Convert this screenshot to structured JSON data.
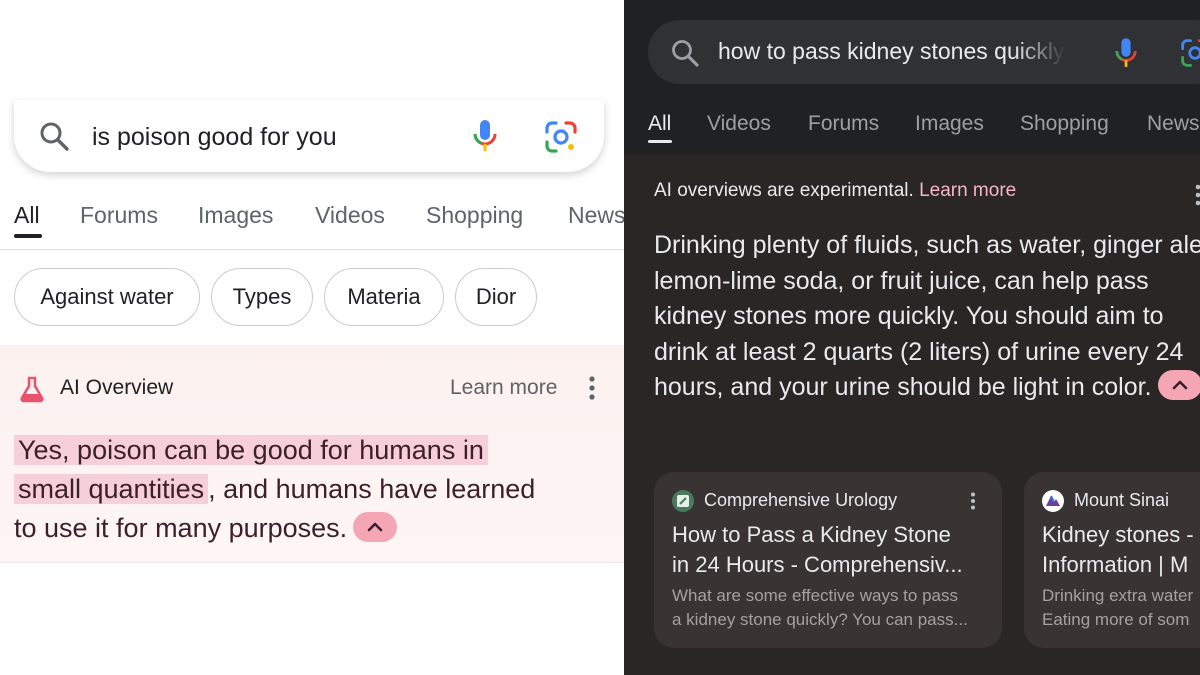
{
  "left": {
    "search": {
      "query": "is poison good for you"
    },
    "tabs": [
      "All",
      "Forums",
      "Images",
      "Videos",
      "Shopping",
      "News"
    ],
    "chips": [
      "Against water",
      "Types",
      "Materia",
      "Dior"
    ],
    "ai_overview": {
      "title": "AI Overview",
      "learn_more": "Learn more",
      "highlight_1": "Yes, poison can be good for humans in",
      "highlight_2": "small quantities",
      "rest_1": ", and humans have learned",
      "rest_2": "to use it for many purposes."
    }
  },
  "right": {
    "search": {
      "query": "how to pass kidney stones quickly"
    },
    "tabs": [
      "All",
      "Videos",
      "Forums",
      "Images",
      "Shopping",
      "News"
    ],
    "ai_overview": {
      "notice": "AI overviews are experimental.",
      "learn_more": "Learn more",
      "answer": "Drinking plenty of fluids, such as water, ginger ale, lemon-lime soda, or fruit juice, can help pass kidney stones more quickly. You should aim to drink at least 2 quarts (2 liters) of urine every 24 hours, and your urine should be light in color."
    },
    "cards": [
      {
        "source": "Comprehensive Urology",
        "title_1": "How to Pass a Kidney Stone",
        "title_2": "in 24 Hours - Comprehensiv...",
        "snippet_1": "What are some effective ways to pass",
        "snippet_2": "a kidney stone quickly? You can pass..."
      },
      {
        "source": "Mount Sinai",
        "title_1": "Kidney stones -",
        "title_2": "Information | M",
        "snippet_1": "Drinking extra water",
        "snippet_2": "Eating more of som"
      }
    ]
  },
  "colors": {
    "highlight_pink": "#f6cfd8",
    "pill_pink": "#f5a6b4",
    "dark_bg": "#202124",
    "dark_overview_bg": "#2a2626",
    "card_bg": "#3a3333"
  }
}
